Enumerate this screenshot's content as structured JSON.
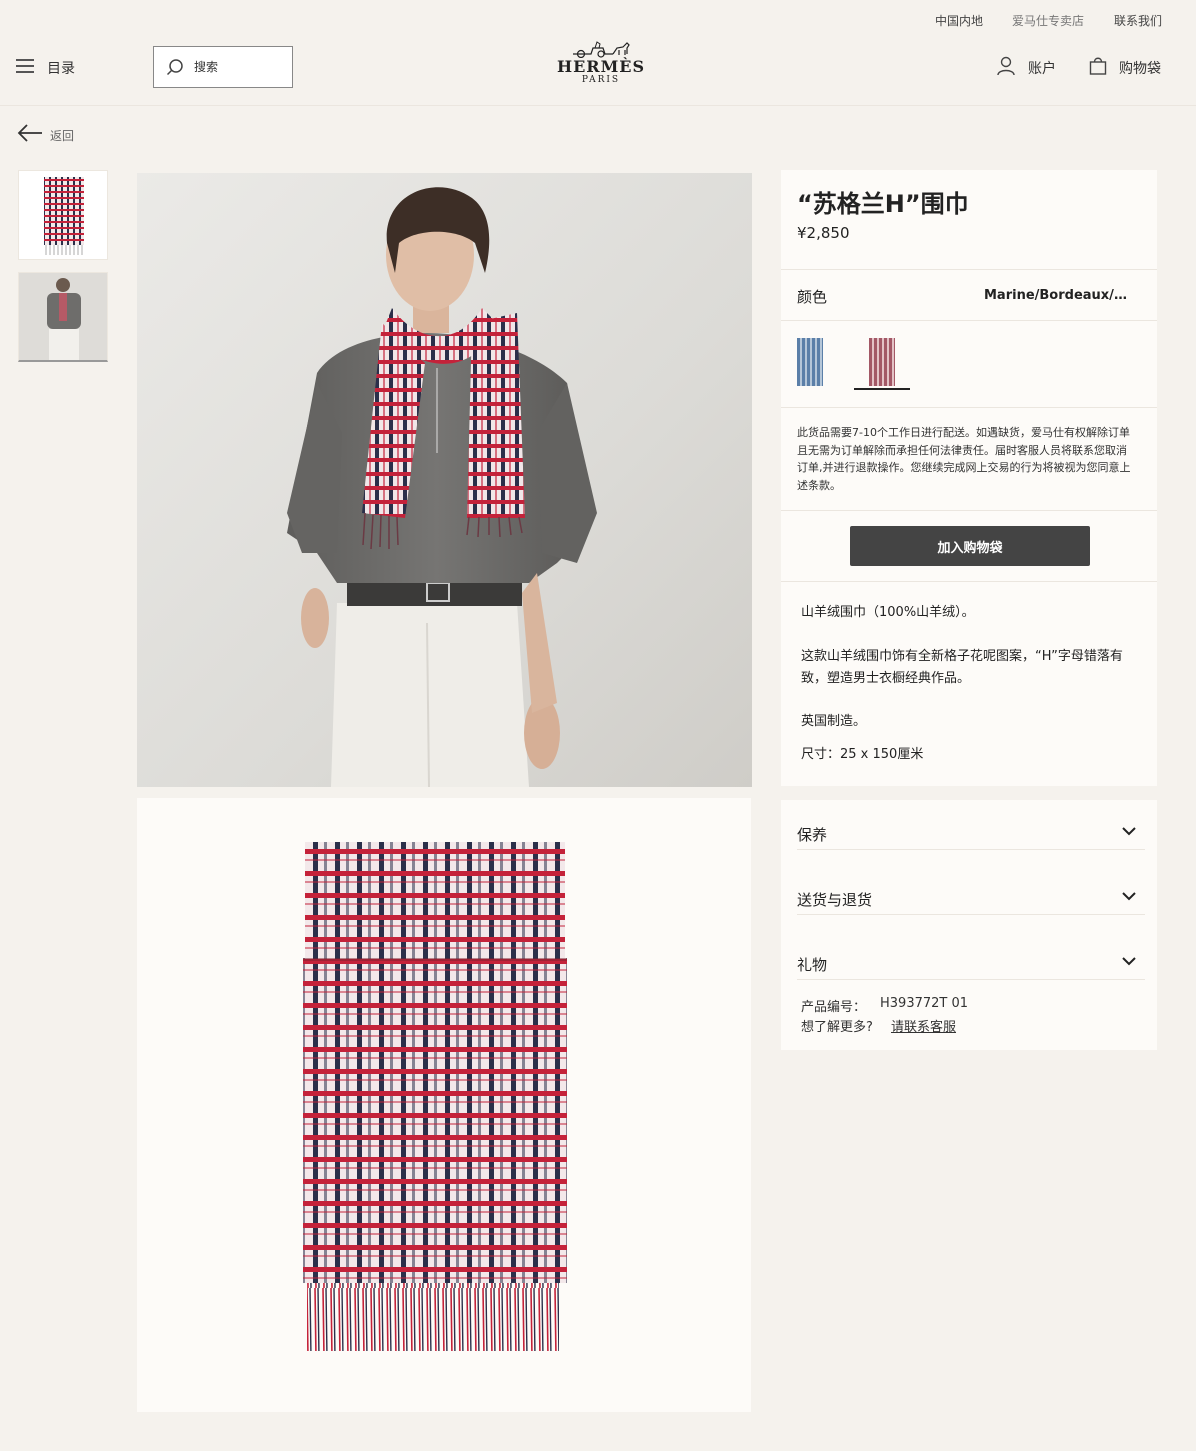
{
  "utility": {
    "region": "中国内地",
    "stores": "爱马仕专卖店",
    "contact": "联系我们"
  },
  "header": {
    "menu_label": "目录",
    "search_placeholder": "搜索",
    "brand": "HERMÈS",
    "brand_sub": "PARIS",
    "account_label": "账户",
    "cart_label": "购物袋"
  },
  "nav": {
    "back_label": "返回"
  },
  "product": {
    "title": "“苏格兰H”围巾",
    "price": "¥2,850",
    "color_label": "颜色",
    "color_value": "Marine/Bordeaux/Gr...",
    "swatches": [
      "blue-colorway",
      "red-colorway"
    ],
    "notice": "此货品需要7-10个工作日进行配送。如遇缺货，爱马仕有权解除订单且无需为订单解除而承担任何法律责任。届时客服人员将联系您取消订单,并进行退款操作。您继续完成网上交易的行为将被视为您同意上述条款。",
    "add_to_bag": "加入购物袋",
    "description": {
      "material": "山羊绒围巾（100%山羊绒）。",
      "detail": "这款山羊绒围巾饰有全新格子花呢图案，“H”字母错落有致，塑造男士衣橱经典作品。",
      "origin": "英国制造。",
      "size": "尺寸：25 x 150厘米"
    }
  },
  "accordion": [
    {
      "label": "保养"
    },
    {
      "label": "送货与退货"
    },
    {
      "label": "礼物"
    }
  ],
  "meta": {
    "sku_label": "产品编号：",
    "sku_value": "H393772T 01",
    "more_label": "想了解更多?",
    "contact_link": "请联系客服"
  },
  "colors": {
    "page_bg": "#f5f2ed",
    "panel_bg": "#fdfbf8",
    "button_bg": "#444444",
    "scarf_red": "#c4223a",
    "scarf_navy": "#2b2f4a"
  }
}
